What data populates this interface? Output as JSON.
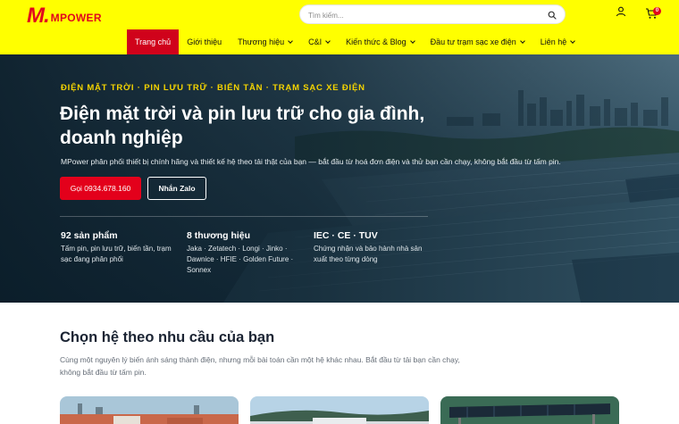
{
  "header": {
    "logo_mark": "M.",
    "logo_text": "MPOWER",
    "search_placeholder": "Tìm kiếm...",
    "cart_count": "0",
    "nav": [
      {
        "label": "Trang chủ",
        "active": true,
        "dropdown": false
      },
      {
        "label": "Giới thiệu",
        "active": false,
        "dropdown": false
      },
      {
        "label": "Thương hiệu",
        "active": false,
        "dropdown": true
      },
      {
        "label": "C&I",
        "active": false,
        "dropdown": true
      },
      {
        "label": "Kiến thức & Blog",
        "active": false,
        "dropdown": true
      },
      {
        "label": "Đầu tư trạm sạc xe điện",
        "active": false,
        "dropdown": true
      },
      {
        "label": "Liên hệ",
        "active": false,
        "dropdown": true
      }
    ]
  },
  "hero": {
    "eyebrow": "ĐIỆN MẶT TRỜI · PIN LƯU TRỮ · BIẾN TẦN · TRẠM SẠC XE ĐIỆN",
    "title": "Điện mặt trời và pin lưu trữ cho gia đình, doanh nghiệp",
    "description": "MPower phân phối thiết bị chính hãng và thiết kế hệ theo tải thật của bạn — bắt đầu từ hoá đơn điện và thử bạn cần chạy, không bắt đầu từ tấm pin.",
    "call_button": "Gọi 0934.678.160",
    "zalo_button": "Nhắn Zalo",
    "stats": [
      {
        "value": "92 sản phẩm",
        "desc": "Tấm pin, pin lưu trữ, biến tần, trạm sạc đang phân phối"
      },
      {
        "value": "8 thương hiệu",
        "desc": "Jaka · Zetatech · Longi · Jinko · Dawnice · HFIE · Golden Future · Sonnex"
      },
      {
        "value": "IEC · CE · TUV",
        "desc": "Chứng nhận và bảo hành nhà sản xuất theo từng dòng"
      }
    ]
  },
  "section": {
    "title": "Chọn hệ theo nhu cầu của bạn",
    "description": "Cùng một nguyên lý biến ánh sáng thành điện, nhưng mỗi bài toán cần một hệ khác nhau. Bắt đầu từ tải bạn cần chạy, không bắt đầu từ tấm pin."
  },
  "colors": {
    "brand_red": "#e1061d",
    "header_yellow": "#ffff00",
    "eyebrow_yellow": "#f5d400"
  }
}
